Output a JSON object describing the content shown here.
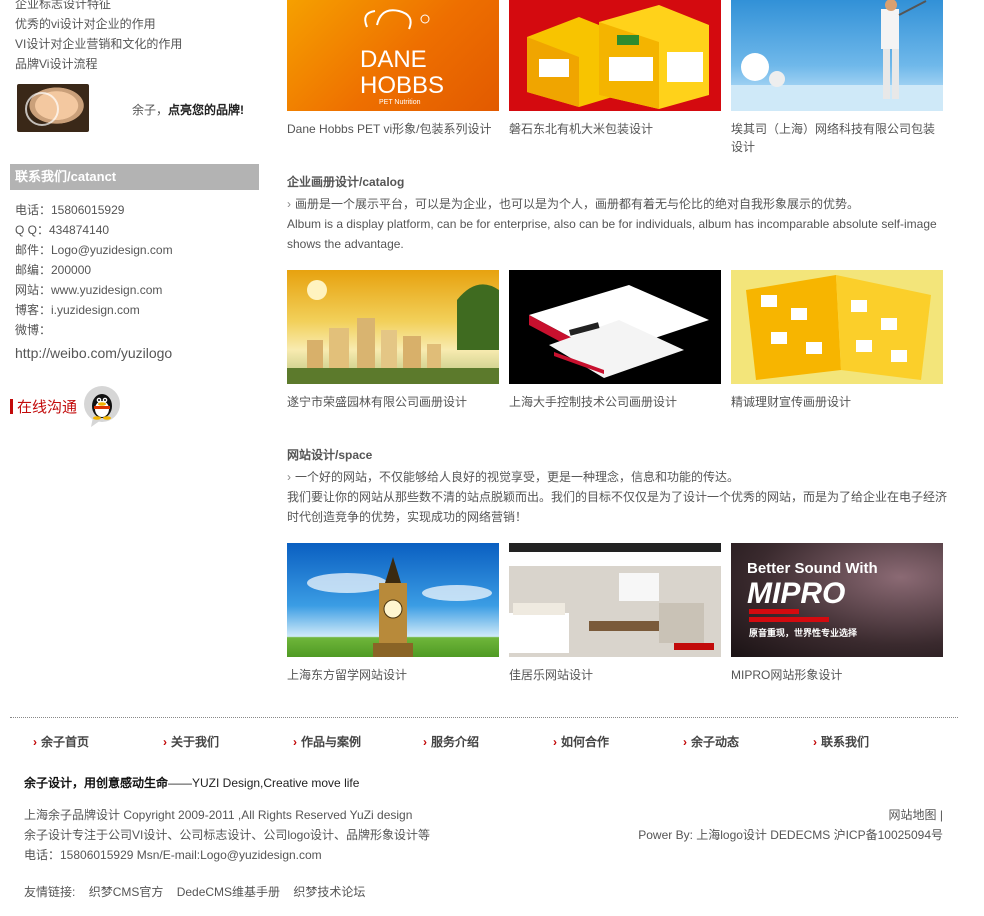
{
  "left": {
    "links": [
      "企业标志设计特征",
      "优秀的vi设计对企业的作用",
      "VI设计对企业营销和文化的作用",
      "品牌Vi设计流程"
    ],
    "promo": {
      "prefix": "余子，",
      "bold": "点亮您的品牌!"
    },
    "contact_title": "联系我们/catanct",
    "contact": [
      "电话：15806015929",
      "Q Q：434874140",
      "邮件：Logo@yuzidesign.com",
      "邮编：200000",
      "网站：www.yuzidesign.com",
      "博客：i.yuzidesign.com",
      "微博："
    ],
    "weibo_url": "http://weibo.com/yuzilogo",
    "online_label": "在线沟通"
  },
  "packaging": {
    "items": [
      {
        "caption": "Dane Hobbs PET vi形象/包装系列设计",
        "logo_line1": "DANE",
        "logo_line2": "HOBBS",
        "logo_sub": "PET Nutrition"
      },
      {
        "caption": "磐石东北有机大米包装设计"
      },
      {
        "caption": "埃其司（上海）网络科技有限公司包装设计"
      }
    ]
  },
  "catalog": {
    "title": "企业画册设计/catalog",
    "desc1": "画册是一个展示平台，可以是为企业，也可以是为个人，画册都有着无与伦比的绝对自我形象展示的优势。",
    "desc2": "Album is a display platform, can be for enterprise, also can be for individuals, album has incomparable absolute self-image shows the advantage.",
    "items": [
      {
        "caption": "遂宁市荣盛园林有限公司画册设计"
      },
      {
        "caption": "上海大手控制技术公司画册设计"
      },
      {
        "caption": "精诚理财宣传画册设计"
      }
    ]
  },
  "web": {
    "title": "网站设计/space",
    "desc1": "一个好的网站，不仅能够给人良好的视觉享受，更是一种理念，信息和功能的传达。",
    "desc2": "我们要让你的网站从那些数不清的站点脱颖而出。我们的目标不仅仅是为了设计一个优秀的网站，而是为了给企业在电子经济时代创造竞争的优势，实现成功的网络营销！",
    "items": [
      {
        "caption": "上海东方留学网站设计"
      },
      {
        "caption": "佳居乐网站设计"
      },
      {
        "caption": "MIPRO网站形象设计",
        "line1": "Better Sound With",
        "line2": "MIPRO",
        "line3": "原音重现，世界性专业选择"
      }
    ]
  },
  "footer": {
    "nav": [
      "余子首页",
      "关于我们",
      "作品与案例",
      "服务介绍",
      "如何合作",
      "余子动态",
      "联系我们"
    ],
    "slogan_bold": "余子设计，用创意感动生命",
    "slogan_rest": "——YUZI Design,Creative move life",
    "left_lines": [
      "上海余子品牌设计 Copyright 2009-2011 ,All Rights Reserved YuZi design",
      "余子设计专注于公司VI设计、公司标志设计、公司logo设计、品牌形象设计等",
      "电话：15806015929 Msn/E-mail:Logo@yuzidesign.com"
    ],
    "right_lines": [
      "网站地图 |",
      "Power By: 上海logo设计 DEDECMS 沪ICP备10025094号"
    ],
    "friends_label": "友情链接:",
    "friends": [
      "织梦CMS官方",
      "DedeCMS维基手册",
      "织梦技术论坛"
    ]
  }
}
